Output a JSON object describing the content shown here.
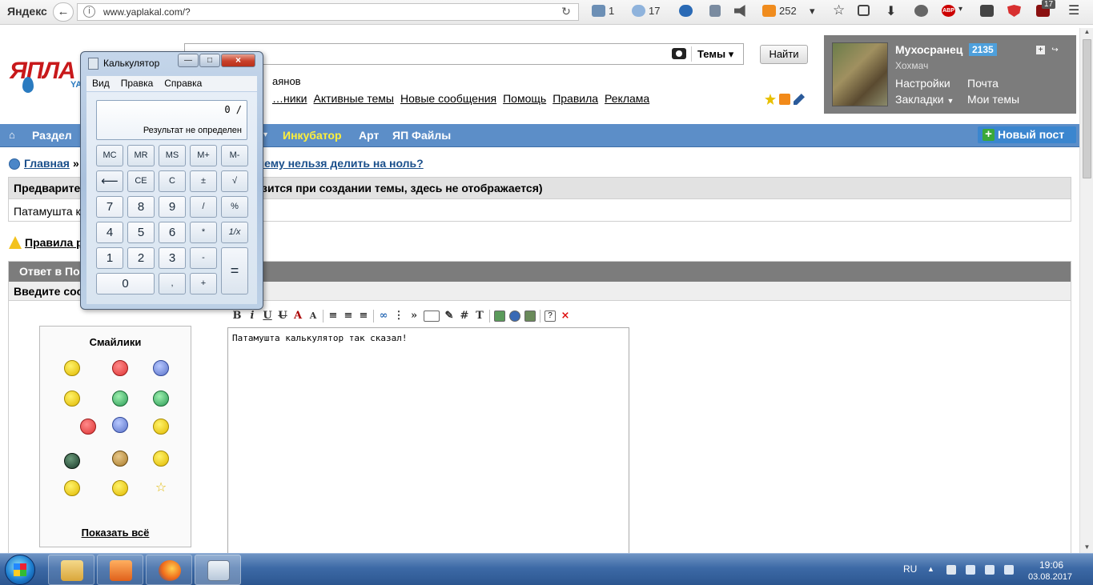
{
  "browser": {
    "brand": "Яндекс",
    "url": "www.yaplakal.com/?",
    "mail_count": "1",
    "weather": "17",
    "counter": "252",
    "ext_badge": "17",
    "adblock": "ABP"
  },
  "site": {
    "logo": "ЯПЛА",
    "logo_sub": "YA",
    "search": {
      "placeholder": "",
      "scope": "Темы",
      "button": "Найти"
    },
    "online_text": "аянов",
    "top_links": [
      "…ники",
      "Активные темы",
      "Новые сообщения",
      "Помощь",
      "Правила",
      "Реклама"
    ],
    "user": {
      "name": "Мухосранец",
      "karma": "2135",
      "rank": "Хохмач",
      "links": {
        "settings": "Настройки",
        "mail": "Почта",
        "bookmarks": "Закладки",
        "my_topics": "Мои темы"
      }
    },
    "nav": {
      "home_icon": "home-icon",
      "sections": "Раздел",
      "incubator": "Инкубатор",
      "art": "Арт",
      "files": "ЯП Файлы",
      "new_post": "Новый пост"
    },
    "breadcrumb": {
      "home": "Главная",
      "sep": "»",
      "topic": "чему нельзя делить на ноль?"
    },
    "preview": {
      "title": "Предварител",
      "title_rest": "зится при создании темы, здесь не отображается)",
      "body": "Патамушта к"
    },
    "rules": "Правила р",
    "reply": {
      "title": "Ответ в По",
      "subtitle": "Введите сооб"
    },
    "smilies": {
      "title": "Смайлики",
      "show_all": "Показать всё"
    },
    "editor": {
      "text": "Патамушта калькулятор так сказал!"
    }
  },
  "calculator": {
    "title": "Калькулятор",
    "menu": [
      "Вид",
      "Правка",
      "Справка"
    ],
    "display_value": "0 /",
    "display_message": "Результат не определен",
    "keys": {
      "mc": "MC",
      "mr": "MR",
      "ms": "MS",
      "mplus": "M+",
      "mminus": "M-",
      "back": "⟵",
      "ce": "CE",
      "c": "C",
      "pm": "±",
      "sqrt": "√",
      "k7": "7",
      "k8": "8",
      "k9": "9",
      "div": "/",
      "pct": "%",
      "k4": "4",
      "k5": "5",
      "k6": "6",
      "mul": "*",
      "inv": "1/x",
      "k1": "1",
      "k2": "2",
      "k3": "3",
      "sub": "-",
      "eq": "=",
      "k0": "0",
      "dec": ",",
      "add": "+"
    }
  },
  "taskbar": {
    "lang": "RU",
    "time": "19:06",
    "date": "03.08.2017"
  }
}
